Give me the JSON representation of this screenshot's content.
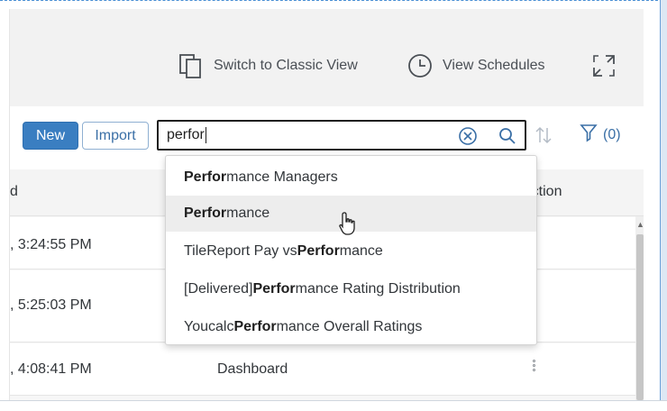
{
  "header": {
    "switch_view_label": "Switch to Classic View",
    "view_schedules_label": "View Schedules"
  },
  "toolbar": {
    "new_label": "New",
    "import_label": "Import",
    "filter_count": "(0)"
  },
  "search": {
    "value": "perfor"
  },
  "suggestions": [
    {
      "pre": "",
      "match": "Perfor",
      "post": "mance Managers"
    },
    {
      "pre": "",
      "match": "Perfor",
      "post": "mance"
    },
    {
      "pre": "TileReport Pay vs ",
      "match": "Perfor",
      "post": "mance"
    },
    {
      "pre": "[Delivered] ",
      "match": "Perfor",
      "post": "mance Rating Distribution"
    },
    {
      "pre": "Youcalc ",
      "match": "Perfor",
      "post": "mance Overall Ratings"
    }
  ],
  "table": {
    "headers": {
      "modified": "d",
      "action": "Action"
    },
    "rows": [
      {
        "modified": ", 3:24:55 PM",
        "type": ""
      },
      {
        "modified": ", 5:25:03 PM",
        "type": ""
      },
      {
        "modified": ", 4:08:41 PM",
        "type": "Dashboard"
      }
    ]
  },
  "colors": {
    "primary_button": "#3a7ec1",
    "link_text": "#3a6fa6",
    "hover_row": "#ededed"
  }
}
